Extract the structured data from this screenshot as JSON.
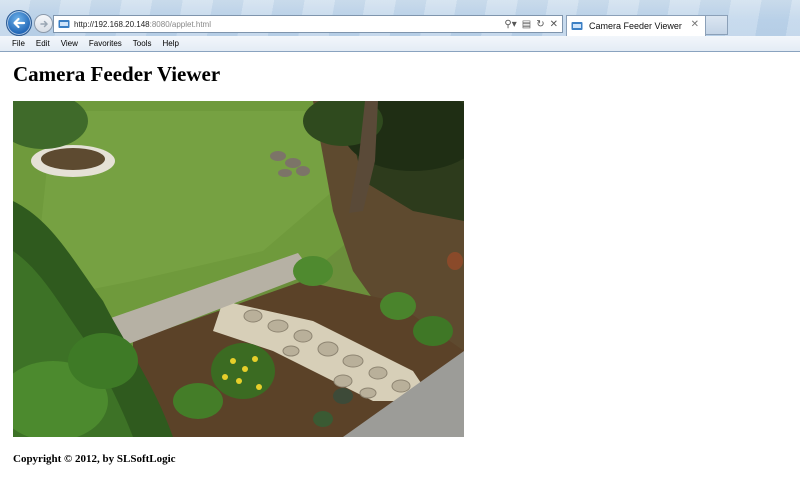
{
  "browser": {
    "address": {
      "url_host": "http://192.168.20.148",
      "url_rest": ":8080/applet.html"
    },
    "tab": {
      "title": "Camera Feeder Viewer"
    },
    "menu": [
      "File",
      "Edit",
      "View",
      "Favorites",
      "Tools",
      "Help"
    ]
  },
  "page": {
    "title": "Camera Feeder Viewer",
    "footer": "Copyright © 2012, by SLSoftLogic"
  },
  "icons": {
    "back": "back-arrow-icon",
    "forward": "forward-arrow-icon",
    "site": "site-icon",
    "search": "search-icon",
    "compat": "compatibility-view-icon",
    "refresh": "refresh-icon",
    "stop": "stop-icon",
    "close": "close-icon"
  },
  "colors": {
    "accent": "#1f64b5",
    "chrome": "#bcd3ea"
  }
}
